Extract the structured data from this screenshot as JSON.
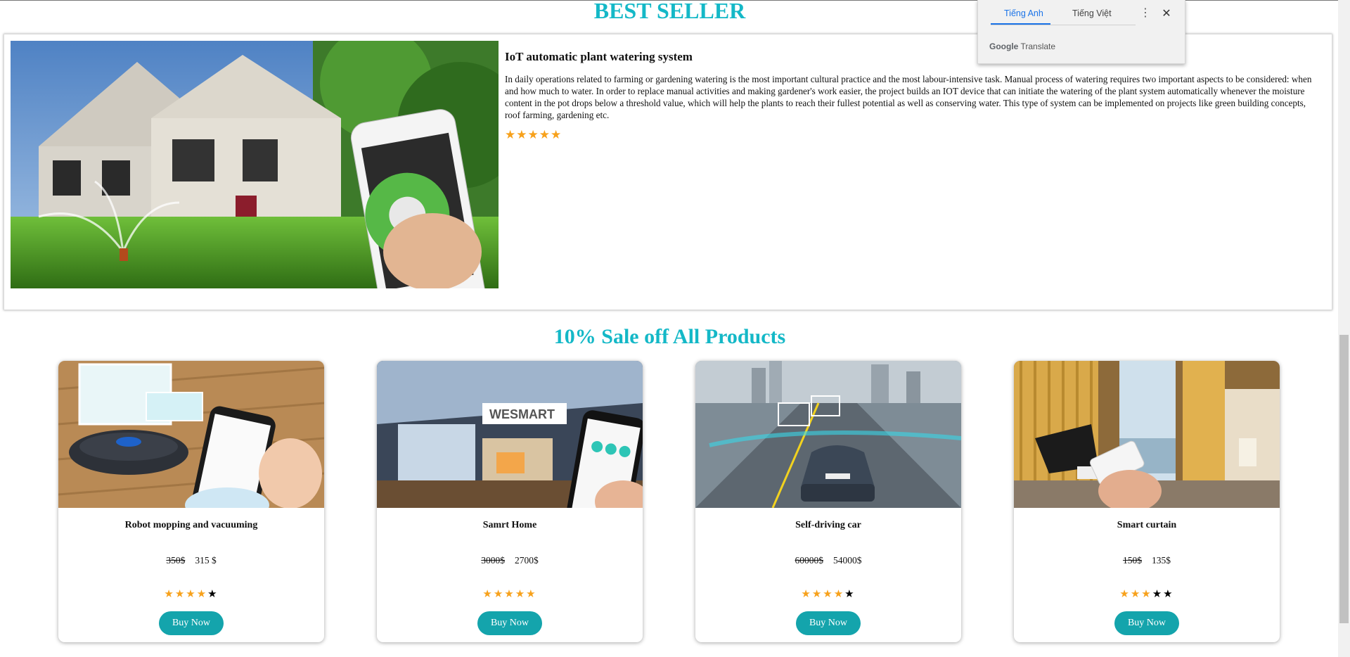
{
  "best_seller": {
    "heading": "BEST SELLER",
    "product": {
      "name": "IoT automatic plant watering system",
      "description": "In daily operations related to farming or gardening watering is the most important cultural practice and the most labour-intensive task. Manual process of watering requires two important aspects to be considered: when and how much to water. In order to replace manual activities and making gardener's work easier, the project builds an IOT device that can initiate the watering of the plant system automatically whenever the moisture content in the pot drops below a threshold value, which will help the plants to reach their fullest potential as well as conserving water. This type of system can be implemented on projects like green building concepts, roof farming, gardening etc.",
      "rating": 5,
      "rating_max": 5
    }
  },
  "sale": {
    "heading": "10% Sale off All Products",
    "products": [
      {
        "name": "Robot mopping and vacuuming",
        "old_price": "350$",
        "new_price": "315 $",
        "rating": 4,
        "rating_max": 5,
        "button": "Buy Now"
      },
      {
        "name": "Samrt Home",
        "old_price": "3000$",
        "new_price": "2700$",
        "rating": 5,
        "rating_max": 5,
        "button": "Buy Now"
      },
      {
        "name": "Self-driving car",
        "old_price": "60000$",
        "new_price": "54000$",
        "rating": 4,
        "rating_max": 5,
        "button": "Buy Now"
      },
      {
        "name": "Smart curtain",
        "old_price": "150$",
        "new_price": "135$",
        "rating": 3,
        "rating_max": 5,
        "button": "Buy Now"
      }
    ]
  },
  "translate_popup": {
    "tabs": [
      "Tiếng Anh",
      "Tiếng Việt"
    ],
    "active_tab": 0,
    "brand_google": "Google",
    "brand_translate": "Translate",
    "more_icon": "more-vert-icon",
    "close_icon": "close-icon"
  },
  "colors": {
    "accent": "#14b8c7",
    "button": "#14a4ac",
    "star_on": "#f7a11b",
    "star_off": "#000000",
    "gt_active": "#1a73e8"
  }
}
